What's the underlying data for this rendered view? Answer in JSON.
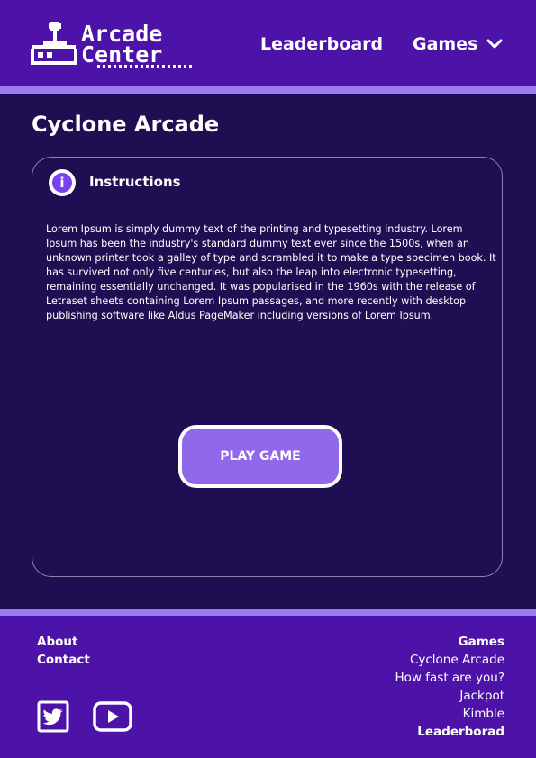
{
  "header": {
    "logo": {
      "line1": "Arcade",
      "line2": "Center"
    },
    "nav": {
      "leaderboard": "Leaderboard",
      "games": "Games"
    }
  },
  "main": {
    "title": "Cyclone Arcade",
    "card": {
      "info_icon_glyph": "i",
      "heading": "Instructions",
      "body": "Lorem Ipsum is simply dummy text of the printing and typesetting industry. Lorem Ipsum has been the industry's standard dummy text ever since the 1500s, when an unknown printer took a galley of type and scrambled it to make a type specimen book. It has survived not only five centuries, but also the leap into electronic typesetting, remaining essentially unchanged. It was popularised in the 1960s with the release of Letraset sheets containing Lorem Ipsum passages, and more recently with desktop publishing software like Aldus PageMaker including versions of Lorem Ipsum.",
      "play_button": "PLAY GAME"
    }
  },
  "footer": {
    "left_links": [
      "About",
      "Contact"
    ],
    "games_heading": "Games",
    "game_links": [
      "Cyclone Arcade",
      "How fast are you?",
      "Jackpot",
      "Kimble"
    ],
    "leaderboard_link": "Leaderborad",
    "social": [
      "twitter-icon",
      "youtube-icon"
    ]
  },
  "colors": {
    "header_bg": "#4d12a8",
    "page_bg": "#1f0f52",
    "stripe": "#9a7bf0",
    "button_bg": "#9168ea",
    "info_icon": "#7b3ff2"
  }
}
